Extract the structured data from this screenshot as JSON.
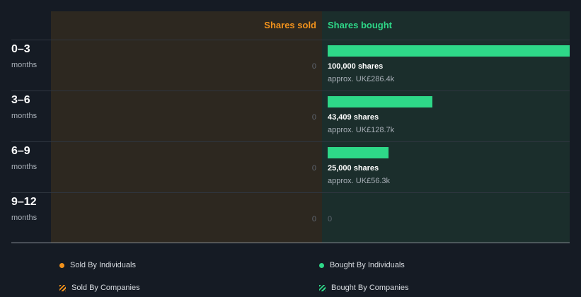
{
  "colors": {
    "sold": "#f2921c",
    "bought": "#2ed888"
  },
  "headers": {
    "sold": "Shares sold",
    "bought": "Shares bought"
  },
  "chart_data": {
    "type": "bar",
    "orientation": "horizontal",
    "categories": [
      "0–3 months",
      "3–6 months",
      "6–9 months",
      "9–12 months"
    ],
    "series": [
      {
        "name": "Shares sold",
        "values": [
          0,
          0,
          0,
          0
        ]
      },
      {
        "name": "Shares bought",
        "values": [
          100000,
          43409,
          25000,
          0
        ]
      }
    ],
    "xlim": [
      0,
      100000
    ],
    "rows": [
      {
        "period": "0–3",
        "unit": "months",
        "sold": 0,
        "sold_label": "0",
        "bought": 100000,
        "bought_label": "100,000 shares",
        "approx": "approx. UK£286.4k"
      },
      {
        "period": "3–6",
        "unit": "months",
        "sold": 0,
        "sold_label": "0",
        "bought": 43409,
        "bought_label": "43,409 shares",
        "approx": "approx. UK£128.7k"
      },
      {
        "period": "6–9",
        "unit": "months",
        "sold": 0,
        "sold_label": "0",
        "bought": 25000,
        "bought_label": "25,000 shares",
        "approx": "approx. UK£56.3k"
      },
      {
        "period": "9–12",
        "unit": "months",
        "sold": 0,
        "sold_label": "0",
        "bought": 0,
        "bought_label": "0",
        "approx": ""
      }
    ]
  },
  "legend": {
    "sold_individuals": "Sold By Individuals",
    "bought_individuals": "Bought By Individuals",
    "sold_companies": "Sold By Companies",
    "bought_companies": "Bought By Companies"
  }
}
